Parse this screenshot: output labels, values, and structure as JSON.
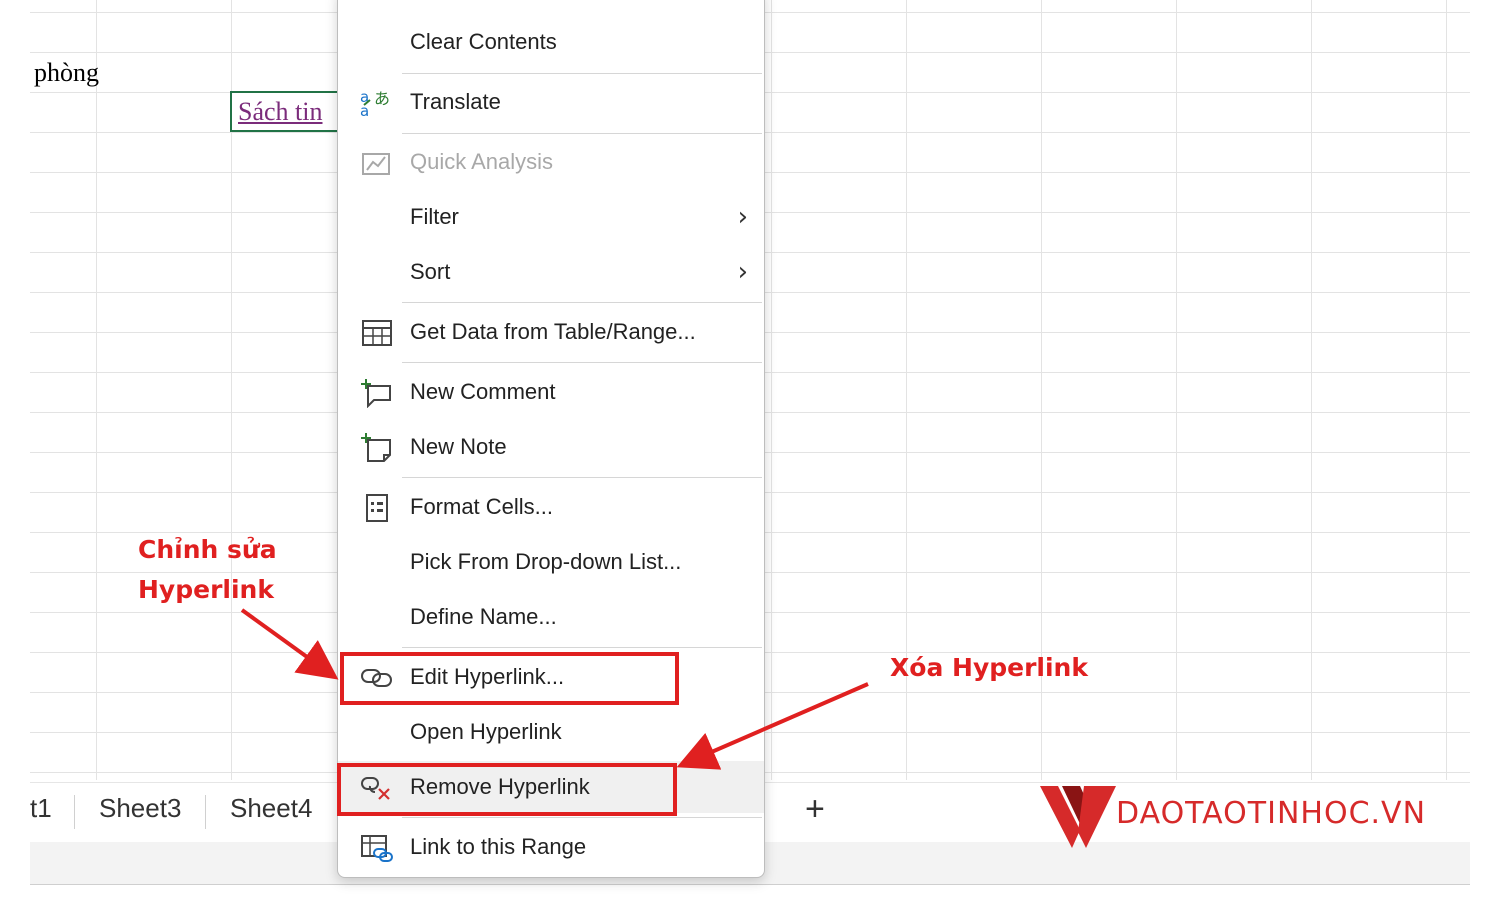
{
  "cells": {
    "a_text": "phòng",
    "selected_text": "Sách tin"
  },
  "sheet_tabs": [
    "t1",
    "Sheet3",
    "Sheet4"
  ],
  "add_sheet_label": "+",
  "context_menu": {
    "items": [
      {
        "label": "Clear Contents",
        "icon": "none",
        "enabled": true
      },
      {
        "label": "Translate",
        "icon": "translate-icon",
        "enabled": true
      },
      {
        "label": "Quick Analysis",
        "icon": "quick-analysis-icon",
        "enabled": false
      },
      {
        "label": "Filter",
        "icon": "none",
        "submenu": true,
        "enabled": true
      },
      {
        "label": "Sort",
        "icon": "none",
        "submenu": true,
        "enabled": true
      },
      {
        "label": "Get Data from Table/Range...",
        "icon": "table-icon",
        "enabled": true
      },
      {
        "label": "New Comment",
        "icon": "new-comment-icon",
        "enabled": true
      },
      {
        "label": "New Note",
        "icon": "new-note-icon",
        "enabled": true
      },
      {
        "label": "Format Cells...",
        "icon": "format-cells-icon",
        "enabled": true
      },
      {
        "label": "Pick From Drop-down List...",
        "icon": "none",
        "enabled": true
      },
      {
        "label": "Define Name...",
        "icon": "none",
        "enabled": true
      },
      {
        "label": "Edit Hyperlink...",
        "icon": "link-icon",
        "enabled": true
      },
      {
        "label": "Open Hyperlink",
        "icon": "none",
        "enabled": true
      },
      {
        "label": "Remove Hyperlink",
        "icon": "remove-link-icon",
        "enabled": true
      },
      {
        "label": "Link to this Range",
        "icon": "link-range-icon",
        "enabled": true
      }
    ]
  },
  "annotations": {
    "edit_line1": "Chỉnh sửa",
    "edit_line2": "Hyperlink",
    "remove": "Xóa Hyperlink",
    "color": "#e02020"
  },
  "logo": {
    "text": "DAOTAOTINHOC.VN",
    "color": "#d62a2a"
  }
}
